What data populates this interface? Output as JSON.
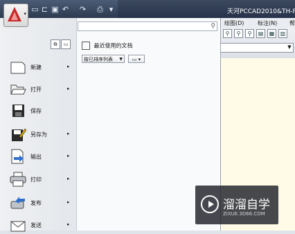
{
  "window": {
    "title": "天河PCCAD2010&TH-P"
  },
  "menu_bar": {
    "items": [
      "绘图(D)",
      "标注(N)",
      "帮"
    ]
  },
  "search": {
    "placeholder": ""
  },
  "left_menu": {
    "items": [
      {
        "label": "新建",
        "icon": "new-doc-icon",
        "has_submenu": true
      },
      {
        "label": "打开",
        "icon": "folder-open-icon",
        "has_submenu": true
      },
      {
        "label": "保存",
        "icon": "floppy-disk-icon",
        "has_submenu": false
      },
      {
        "label": "另存为",
        "icon": "save-as-icon",
        "has_submenu": true
      },
      {
        "label": "输出",
        "icon": "export-icon",
        "has_submenu": true
      },
      {
        "label": "打印",
        "icon": "printer-icon",
        "has_submenu": true
      },
      {
        "label": "发布",
        "icon": "publish-icon",
        "has_submenu": true
      },
      {
        "label": "发送",
        "icon": "send-icon",
        "has_submenu": true
      }
    ],
    "submenu_arrow": "▸"
  },
  "recent": {
    "header": "最近使用的文档",
    "sort_label": "按已排序列表",
    "sort_caret": "▼",
    "view_label": "▭ ▾"
  },
  "watermark": {
    "title": "溜溜自学",
    "url": "ZIXUE.3D66.COM"
  },
  "colors": {
    "canvas": "#fffbe6",
    "accent_red": "#c62828",
    "title_bar": "#2d3a4f"
  }
}
